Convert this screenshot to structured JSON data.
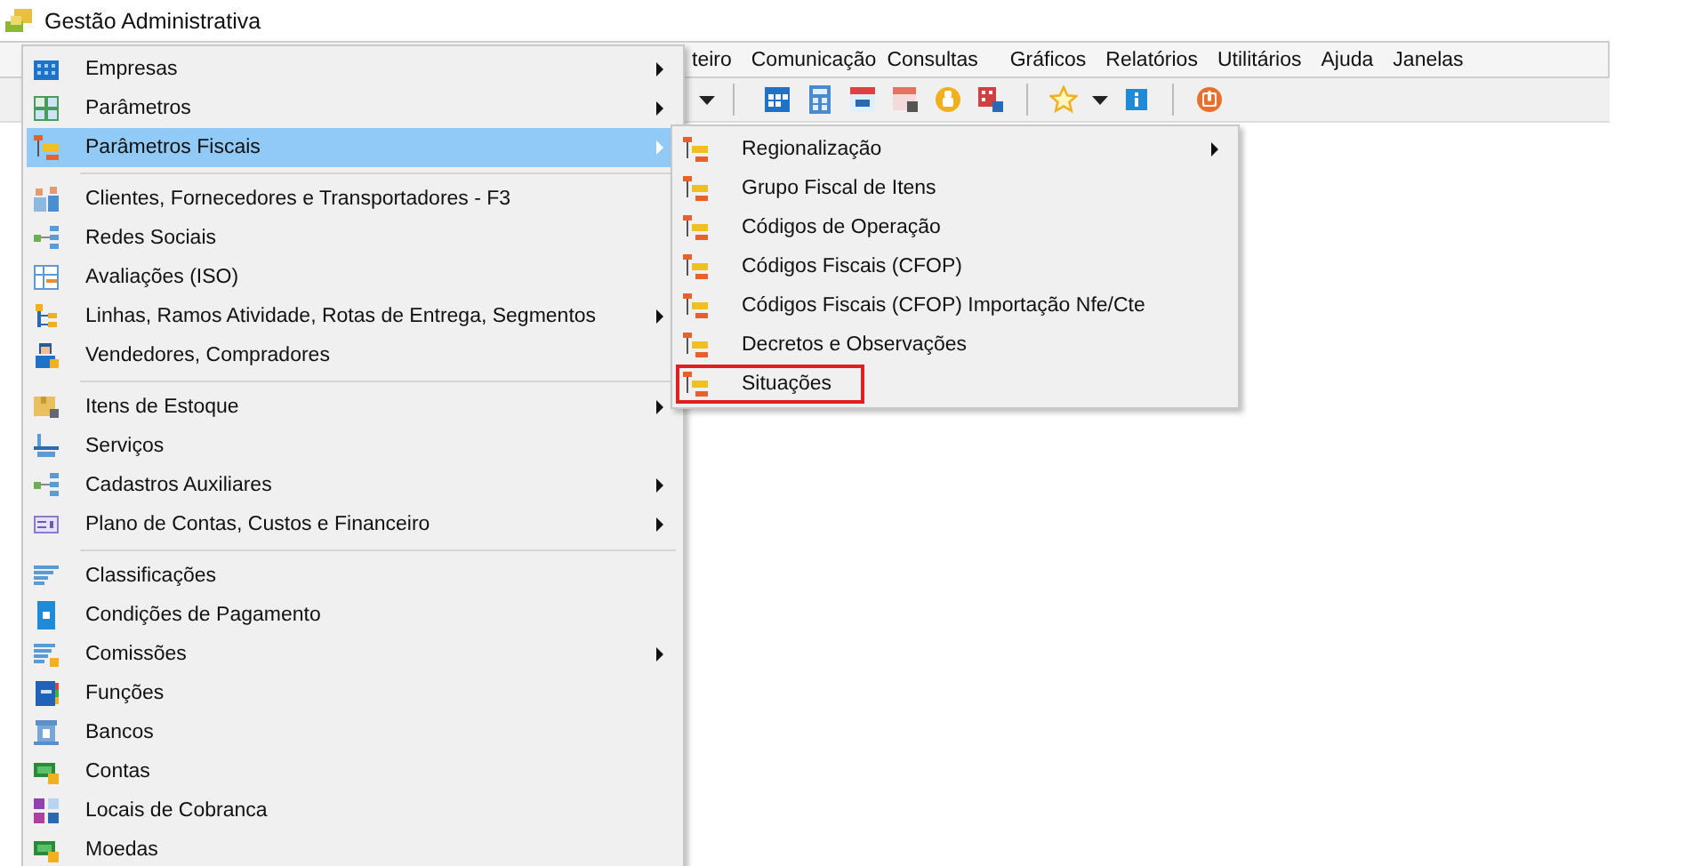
{
  "window": {
    "title": "Gestão Administrativa"
  },
  "menu_bar": [
    "teiro",
    "Comunicação",
    "Consultas",
    "Gráficos",
    "Relatórios",
    "Utilitários",
    "Ajuda",
    "Janelas"
  ],
  "menu": {
    "groups": [
      [
        {
          "label": "Empresas",
          "submenu": true,
          "selected": false
        },
        {
          "label": "Parâmetros",
          "submenu": true,
          "selected": false
        },
        {
          "label": "Parâmetros Fiscais",
          "submenu": true,
          "selected": true
        }
      ],
      [
        {
          "label": "Clientes, Fornecedores e Transportadores - F3",
          "submenu": false,
          "selected": false
        },
        {
          "label": "Redes Sociais",
          "submenu": false,
          "selected": false
        },
        {
          "label": "Avaliações (ISO)",
          "submenu": false,
          "selected": false
        },
        {
          "label": "Linhas, Ramos Atividade, Rotas de Entrega, Segmentos",
          "submenu": true,
          "selected": false
        },
        {
          "label": "Vendedores, Compradores",
          "submenu": false,
          "selected": false
        }
      ],
      [
        {
          "label": "Itens de Estoque",
          "submenu": true,
          "selected": false
        },
        {
          "label": "Serviços",
          "submenu": false,
          "selected": false
        },
        {
          "label": "Cadastros Auxiliares",
          "submenu": true,
          "selected": false
        },
        {
          "label": "Plano de Contas, Custos e Financeiro",
          "submenu": true,
          "selected": false
        }
      ],
      [
        {
          "label": "Classificações",
          "submenu": false,
          "selected": false
        },
        {
          "label": "Condições de Pagamento",
          "submenu": false,
          "selected": false
        },
        {
          "label": "Comissões",
          "submenu": true,
          "selected": false
        },
        {
          "label": "Funções",
          "submenu": false,
          "selected": false
        },
        {
          "label": "Bancos",
          "submenu": false,
          "selected": false
        },
        {
          "label": "Contas",
          "submenu": false,
          "selected": false
        },
        {
          "label": "Locais de Cobranca",
          "submenu": false,
          "selected": false
        },
        {
          "label": "Moedas",
          "submenu": false,
          "selected": false
        }
      ]
    ]
  },
  "submenu": {
    "items": [
      {
        "label": "Regionalização",
        "submenu": true,
        "highlighted": false
      },
      {
        "label": "Grupo Fiscal de Itens",
        "submenu": false,
        "highlighted": false
      },
      {
        "label": "Códigos de Operação",
        "submenu": false,
        "highlighted": false
      },
      {
        "label": "Códigos Fiscais (CFOP)",
        "submenu": false,
        "highlighted": false
      },
      {
        "label": "Códigos Fiscais (CFOP)  Importação Nfe/Cte",
        "submenu": false,
        "highlighted": false
      },
      {
        "label": "Decretos e Observações",
        "submenu": false,
        "highlighted": false
      },
      {
        "label": "Situações",
        "submenu": false,
        "highlighted": true
      }
    ]
  }
}
